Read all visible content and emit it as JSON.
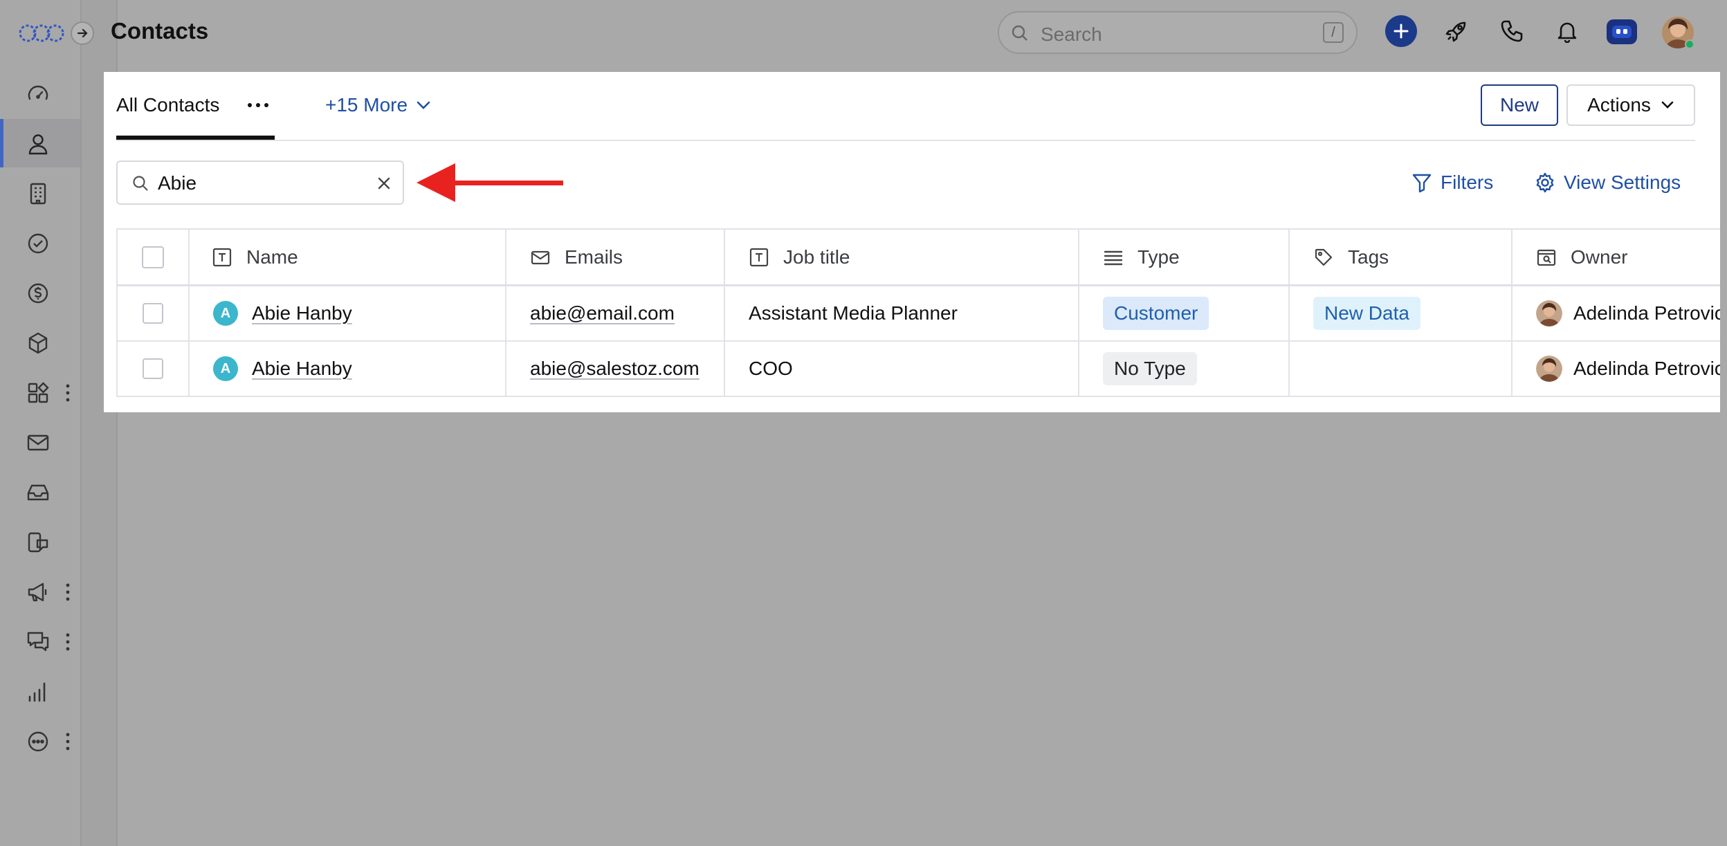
{
  "header": {
    "title": "Contacts"
  },
  "global_search": {
    "placeholder": "Search",
    "shortcut": "/"
  },
  "sidebar": {
    "items": [
      {
        "icon": "dashboard-gauge-icon"
      },
      {
        "icon": "person-icon",
        "active": true
      },
      {
        "icon": "building-icon"
      },
      {
        "icon": "check-circle-icon"
      },
      {
        "icon": "dollar-circle-icon"
      },
      {
        "icon": "cube-icon"
      },
      {
        "icon": "apps-grid-icon",
        "has_more": true
      },
      {
        "icon": "mail-icon"
      },
      {
        "icon": "inbox-icon"
      },
      {
        "icon": "phone-chat-icon"
      },
      {
        "icon": "megaphone-icon",
        "has_more": true
      },
      {
        "icon": "chat-bubbles-icon",
        "has_more": true
      },
      {
        "icon": "bar-chart-icon"
      },
      {
        "icon": "more-circle-icon",
        "has_more": true
      }
    ]
  },
  "views": {
    "active_tab": "All Contacts",
    "more_tabs": "+15 More"
  },
  "toolbar": {
    "new_label": "New",
    "actions_label": "Actions",
    "filters_label": "Filters",
    "view_settings_label": "View Settings"
  },
  "list_search": {
    "value": "Abie"
  },
  "table": {
    "columns": [
      "Name",
      "Emails",
      "Job title",
      "Type",
      "Tags",
      "Owner"
    ],
    "rows": [
      {
        "initial": "A",
        "name": "Abie Hanby",
        "email": "abie@email.com",
        "job_title": "Assistant Media Planner",
        "type": "Customer",
        "tag": "New Data",
        "owner": "Adelinda Petrovic"
      },
      {
        "initial": "A",
        "name": "Abie Hanby",
        "email": "abie@salestoz.com",
        "job_title": "COO",
        "type": "No Type",
        "tag": "",
        "owner": "Adelinda Petrovic"
      }
    ]
  },
  "colors": {
    "accent": "#1f4fa3",
    "brand_dark": "#1c3a8a",
    "annotation_arrow": "#e8231f",
    "customer_pill": "#dbe9fb",
    "tag_pill": "#dff2fb"
  }
}
